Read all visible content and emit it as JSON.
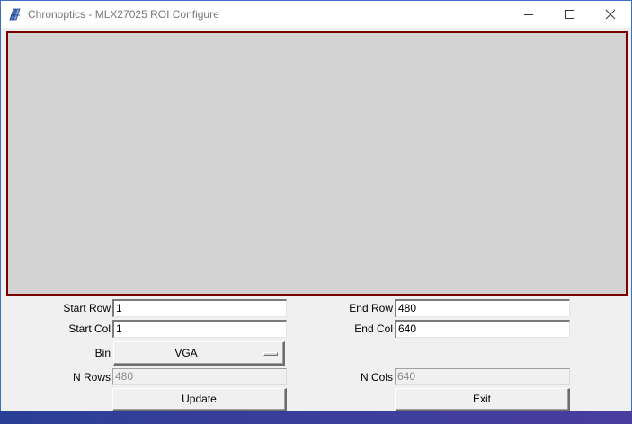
{
  "window": {
    "title": "Chronoptics - MLX27025 ROI Configure"
  },
  "fields": {
    "start_row": {
      "label": "Start Row",
      "value": "1"
    },
    "end_row": {
      "label": "End Row",
      "value": "480"
    },
    "start_col": {
      "label": "Start Col",
      "value": "1"
    },
    "end_col": {
      "label": "End Col",
      "value": "640"
    },
    "bin": {
      "label": "Bin",
      "value": "VGA"
    },
    "n_rows": {
      "label": "N Rows",
      "value": "480"
    },
    "n_cols": {
      "label": "N Cols",
      "value": "640"
    }
  },
  "buttons": {
    "update": "Update",
    "exit": "Exit"
  },
  "icons": {
    "app": "chronoptics-app-icon",
    "minimize": "minimize-icon",
    "maximize": "maximize-icon",
    "close": "close-icon"
  },
  "colors": {
    "canvas_bg": "#d3d3d3",
    "canvas_border": "#7a0000",
    "window_bg": "#f0f0f0"
  }
}
